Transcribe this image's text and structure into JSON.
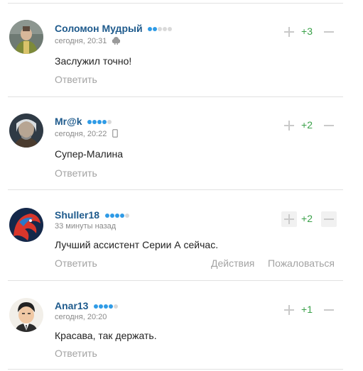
{
  "comments": [
    {
      "author": "Соломон Мудрый",
      "rating_dots_on": 2,
      "rating_dots_total": 5,
      "time": "сегодня, 20:31",
      "device_icon": "android-icon",
      "text": "Заслужил точно!",
      "reply": "Ответить",
      "score": "+3"
    },
    {
      "author": "Mr@k",
      "rating_dots_on": 4,
      "rating_dots_total": 5,
      "time": "сегодня, 20:22",
      "device_icon": "mobile-phone-icon",
      "text": "Супер-Малина",
      "reply": "Ответить",
      "score": "+2"
    },
    {
      "author": "Shuller18",
      "rating_dots_on": 4,
      "rating_dots_total": 5,
      "time": "33 минуты назад",
      "text": "Лучший ассистент Серии А сейчас.",
      "reply": "Ответить",
      "actions": "Действия",
      "complain": "Пожаловаться",
      "score": "+2"
    },
    {
      "author": "Anar13",
      "rating_dots_on": 4,
      "rating_dots_total": 5,
      "time": "сегодня, 20:20",
      "text": "Красава, так держать.",
      "reply": "Ответить",
      "score": "+1"
    }
  ],
  "colors": {
    "author": "#1e5a8c",
    "score_positive": "#3aa149",
    "muted": "#a3a3a3",
    "rating_on": "#2f9be6",
    "rating_off": "#d9d9d9"
  }
}
